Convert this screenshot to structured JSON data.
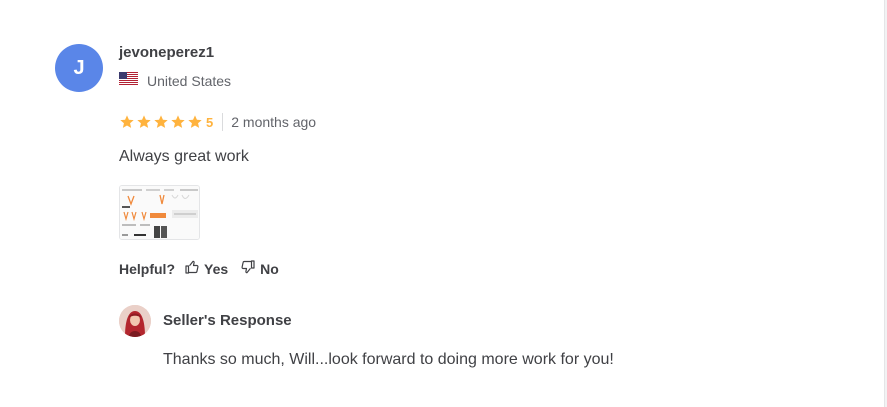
{
  "review": {
    "avatar_initial": "J",
    "username": "jevoneperez1",
    "country": "United States",
    "flag_icon": "us-flag-icon",
    "rating": 5,
    "rating_label": "5",
    "time_ago": "2 months ago",
    "text": "Always great work",
    "star_color": "#ffb33e"
  },
  "helpful": {
    "label": "Helpful?",
    "yes_label": "Yes",
    "no_label": "No"
  },
  "seller_response": {
    "title": "Seller's Response",
    "text": "Thanks so much, Will...look forward to doing more work for you!"
  },
  "colors": {
    "avatar_bg": "#5a86e8",
    "text_primary": "#404145",
    "text_secondary": "#62646a"
  }
}
